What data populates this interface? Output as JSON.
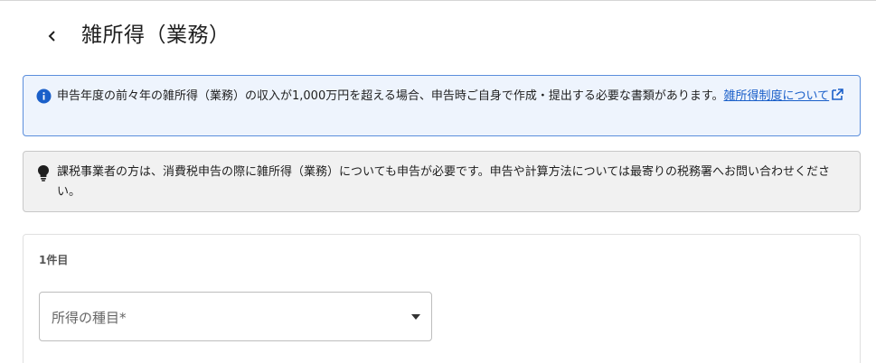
{
  "header": {
    "title": "雑所得（業務）"
  },
  "info_notice": {
    "text": "申告年度の前々年の雑所得（業務）の収入が1,000万円を超える場合、申告時ご自身で作成・提出する必要な書類があります。",
    "link_text": "雑所得制度について",
    "accent_color": "#1a5fc9"
  },
  "tip_notice": {
    "text": "課税事業者の方は、消費税申告の際に雑所得（業務）についても申告が必要です。申告や計算方法については最寄りの税務署へお問い合わせください。"
  },
  "entry": {
    "label": "1件目",
    "select_label": "所得の種目*"
  }
}
